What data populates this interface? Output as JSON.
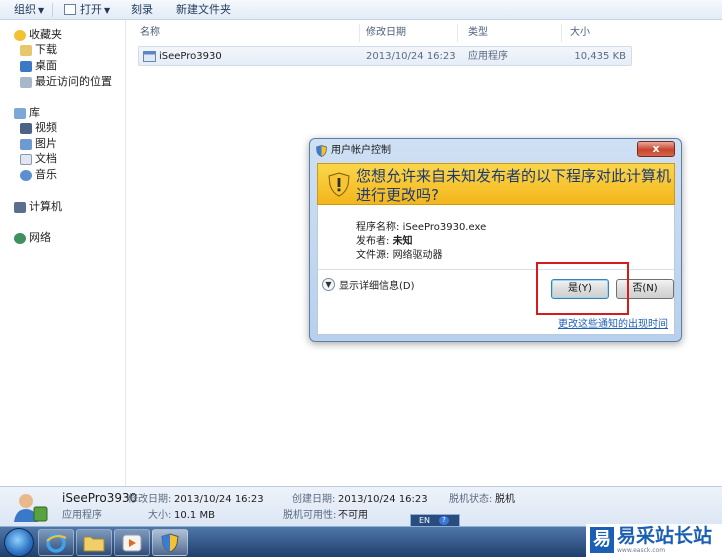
{
  "toolbar": {
    "organize": "组织",
    "open": "打开",
    "burn": "刻录",
    "new_folder": "新建文件夹"
  },
  "nav": {
    "favorites": "收藏夹",
    "downloads": "下载",
    "desktop": "桌面",
    "recent": "最近访问的位置",
    "libraries": "库",
    "videos": "视频",
    "pictures": "图片",
    "documents": "文档",
    "music": "音乐",
    "computer": "计算机",
    "network": "网络"
  },
  "file_list": {
    "columns": [
      "名称",
      "修改日期",
      "类型",
      "大小"
    ],
    "rows": [
      {
        "name": "iSeePro3930",
        "modified": "2013/10/24 16:23",
        "type": "应用程序",
        "size": "10,435 KB"
      }
    ]
  },
  "dialog": {
    "title": "用户帐户控制",
    "close_label": "x",
    "question": "您想允许来自未知发布者的以下程序对此计算机进行更改吗?",
    "program_name_label": "程序名称:",
    "program_name": "iSeePro3930.exe",
    "publisher_label": "发布者:",
    "publisher": "未知",
    "file_origin_label": "文件源:",
    "file_origin": "网络驱动器",
    "show_details": "显示详细信息(D)",
    "yes_button": "是(Y)",
    "no_button": "否(N)",
    "change_link": "更改这些通知的出现时间"
  },
  "details_pane": {
    "name": "iSeePro3930",
    "type": "应用程序",
    "modified_label": "修改日期:",
    "modified": "2013/10/24 16:23",
    "size_label": "大小:",
    "size": "10.1 MB",
    "created_label": "创建日期:",
    "created": "2013/10/24 16:23",
    "offline_status_label": "脱机状态:",
    "offline_status": "脱机",
    "offline_avail_label": "脱机可用性:",
    "offline_avail": "不可用"
  },
  "taskbar": {
    "language": "EN",
    "help": "?"
  },
  "watermark": {
    "logo_char": "易",
    "text": "易采站长站",
    "sub": "www.easck.com"
  },
  "colors": {
    "uac_banner": "#f3b61c",
    "highlight_box": "#d51c1c",
    "link": "#1f5fb8"
  }
}
